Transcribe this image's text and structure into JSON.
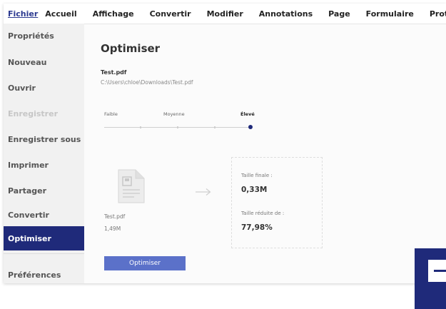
{
  "menu": [
    "Fichier",
    "Accueil",
    "Affichage",
    "Convertir",
    "Modifier",
    "Annotations",
    "Page",
    "Formulaire",
    "Protect"
  ],
  "sidebar": {
    "items": [
      {
        "label": "Propriétés"
      },
      {
        "label": "Nouveau"
      },
      {
        "label": "Ouvrir"
      },
      {
        "label": "Enregistrer",
        "disabled": true
      },
      {
        "label": "Enregistrer sous"
      },
      {
        "label": "Imprimer"
      },
      {
        "label": "Partager"
      },
      {
        "label": "Convertir"
      },
      {
        "label": "Optimiser",
        "active": true
      },
      {
        "label": "Préférences"
      }
    ]
  },
  "main": {
    "title": "Optimiser",
    "file_name": "Test.pdf",
    "file_path": "C:\\Users\\chloe\\Downloads\\Test.pdf",
    "levels": [
      "Faible",
      "Moyenne",
      "Élevé"
    ],
    "selected_level": "Élevé",
    "source": {
      "name": "Test.pdf",
      "size": "1,49M"
    },
    "result": {
      "final_size_label": "Taille finale :",
      "final_size_value": "0,33M",
      "reduced_label": "Taille réduite de :",
      "reduced_value": "77,98%"
    },
    "button_label": "Optimiser"
  },
  "colors": {
    "accent": "#1f2a7a",
    "button": "#5b71c9",
    "sidebar_bg": "#f1f1f1"
  },
  "icons": [
    "document-icon",
    "arrow-right-icon",
    "app-logo-icon"
  ]
}
